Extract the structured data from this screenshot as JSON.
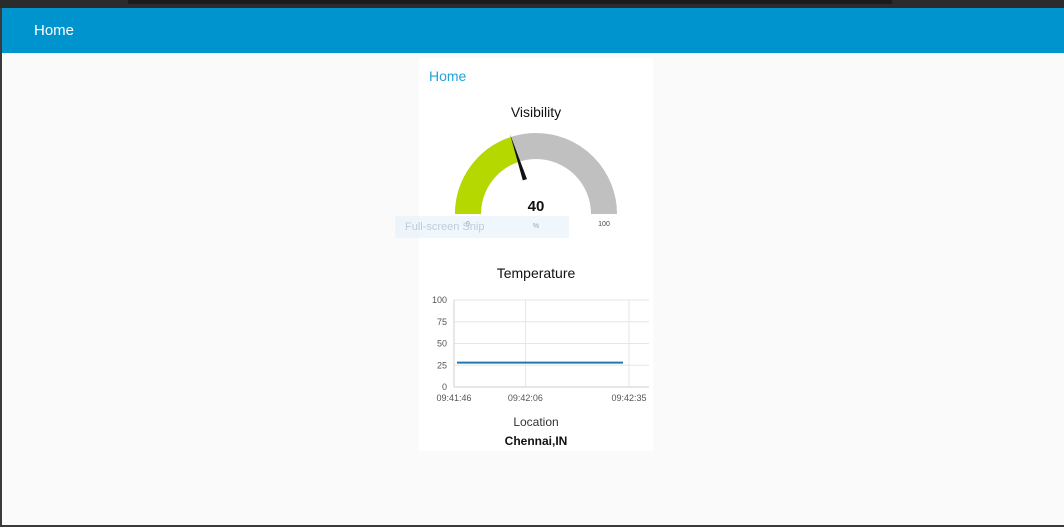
{
  "toolbar": {
    "title": "Home",
    "color": "#0094ce"
  },
  "group": {
    "title": "Home"
  },
  "gauge": {
    "title": "Visibility",
    "value": 40,
    "value_label": "40",
    "min": 0,
    "max": 100,
    "min_label": "0",
    "max_label": "100",
    "unit": "%",
    "fill_color": "#b5d900",
    "track_color": "#c0c0c0"
  },
  "overlay": {
    "text": "Full-screen Snip"
  },
  "chart_data": {
    "type": "line",
    "title": "Temperature",
    "x": [
      "09:41:46",
      "09:42:35"
    ],
    "x_ticks": [
      "09:41:46",
      "09:42:06",
      "09:42:35"
    ],
    "series": [
      {
        "values": [
          28,
          28
        ],
        "color": "#1f77b4"
      }
    ],
    "ylim": [
      0,
      100
    ],
    "y_ticks": [
      "100",
      "75",
      "50",
      "25",
      "0"
    ],
    "grid": true
  },
  "location": {
    "label": "Location",
    "value": "Chennai,IN"
  }
}
